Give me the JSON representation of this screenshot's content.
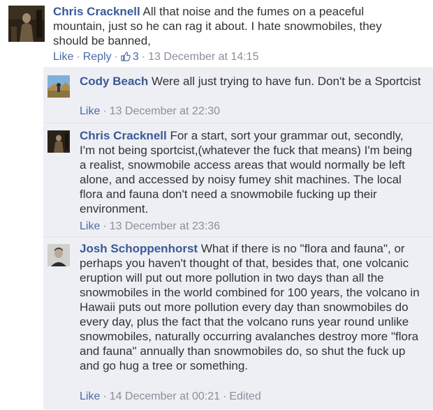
{
  "comments": [
    {
      "author": "Chris Cracknell",
      "text": "All that noise and the fumes on a peaceful mountain, just so he can rag it about. I hate snowmobiles, they should be banned,",
      "actions": {
        "like": "Like",
        "reply": "Reply",
        "like_count": "3",
        "timestamp": "13 December at 14:15"
      }
    }
  ],
  "replies": [
    {
      "author": "Cody Beach",
      "text": "Were all just trying to have fun. Don't be a Sportcist",
      "actions": {
        "like": "Like",
        "timestamp": "13 December at 22:30"
      }
    },
    {
      "author": "Chris Cracknell",
      "text": "For a start, sort your grammar out, secondly, I'm not being sportcist,(whatever the fuck that means) I'm being a realist, snowmobile access areas that would normally be left alone, and accessed by noisy fumey shit machines. The local flora and fauna don't need a snowmobile fucking up their environment.",
      "actions": {
        "like": "Like",
        "timestamp": "13 December at 23:36"
      }
    },
    {
      "author": "Josh Schoppenhorst",
      "text": "What if there is no \"flora and fauna\", or perhaps you haven't thought of that, besides that, one volcanic eruption will put out more pollution in two days than all the snowmobiles in the world combined for 100 years, the volcano in Hawaii puts out more pollution every day than snowmobiles do every day, plus the fact that the volcano runs year round unlike snowmobiles, naturally occurring avalanches destroy more \"flora and fauna\" annually than snowmobiles do, so shut the fuck up and go hug a tree or something.",
      "actions": {
        "like": "Like",
        "timestamp": "14 December at 00:21",
        "edited": "Edited"
      }
    }
  ],
  "separator": "·",
  "icons": {
    "avatar_chris": "avatar-dark-figure",
    "avatar_cody": "avatar-landscape",
    "avatar_josh": "avatar-portrait",
    "like_count": "thumbs-up-icon"
  },
  "colors": {
    "author": "#3b5998",
    "link": "#4a6aa5",
    "meta": "#8a8f9c",
    "reply_background": "#edeff4"
  }
}
